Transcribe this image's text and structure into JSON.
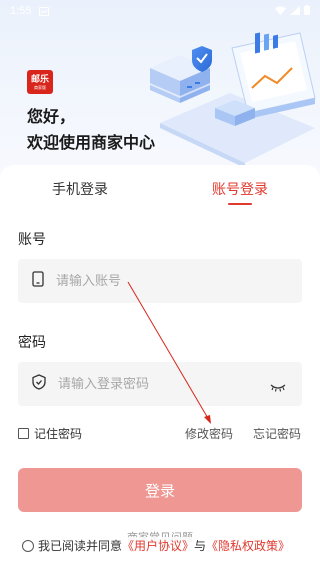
{
  "status_bar": {
    "time": "1:55"
  },
  "brand": {
    "logo_text": "邮乐",
    "logo_subtext": "商家版"
  },
  "greeting": {
    "line1": "您好，",
    "line2": "欢迎使用商家中心"
  },
  "tabs": [
    {
      "label": "手机登录",
      "active": false
    },
    {
      "label": "账号登录",
      "active": true
    }
  ],
  "account": {
    "label": "账号",
    "placeholder": "请输入账号",
    "value": ""
  },
  "password": {
    "label": "密码",
    "placeholder": "请输入登录密码",
    "value": ""
  },
  "remember": {
    "label": "记住密码",
    "checked": false
  },
  "links": {
    "modify_password": "修改密码",
    "forgot_password": "忘记密码"
  },
  "login_button": "登录",
  "faq": "商家常见问题",
  "agreement": {
    "prefix": "我已阅读并同意",
    "user_agreement": "《用户协议》",
    "conjunction": "与",
    "privacy_policy": "《隐私权政策》",
    "checked": false
  },
  "colors": {
    "accent": "#e0392f",
    "button_disabled": "#ef9793",
    "input_bg": "#f5f5f5",
    "hero_bg": "#eaf1fc"
  }
}
